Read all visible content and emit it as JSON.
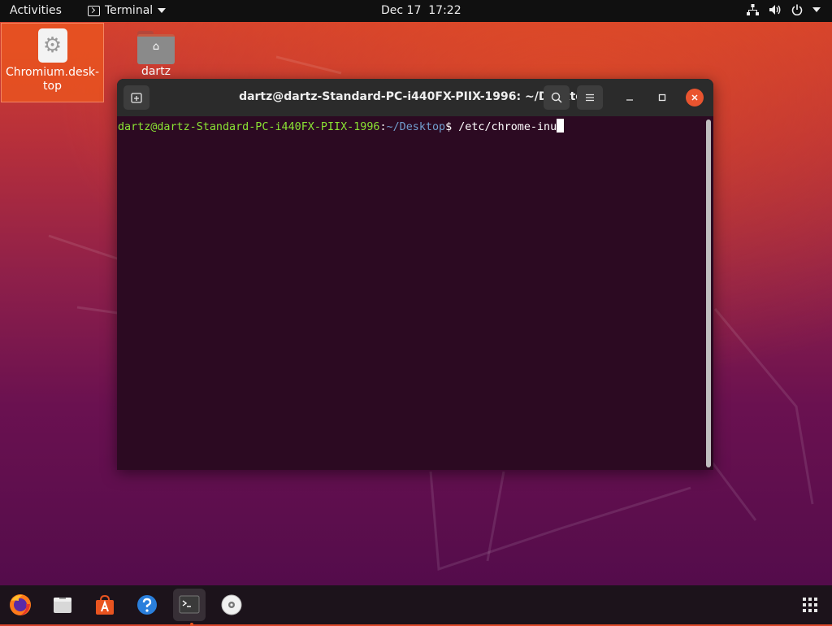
{
  "topbar": {
    "activities": "Activities",
    "app_name": "Terminal",
    "date": "Dec 17",
    "time": "17:22"
  },
  "desktop": {
    "icons": [
      {
        "label_line1": "Chromium.desk-",
        "label_line2": "top",
        "icon": "gear-icon",
        "selected": true
      },
      {
        "label": "dartz",
        "icon": "home-folder-icon"
      }
    ]
  },
  "terminal": {
    "title": "dartz@dartz-Standard-PC-i440FX-PIIX-1996: ~/Desktop",
    "prompt_user": "dartz@dartz-Standard-PC-i440FX-PIIX-1996",
    "prompt_sep": ":",
    "prompt_path": "~/Desktop",
    "prompt_symbol": "$ ",
    "command": "/etc/chrome-inu"
  },
  "dock": {
    "items": [
      {
        "name": "firefox-icon"
      },
      {
        "name": "files-icon"
      },
      {
        "name": "software-center-icon"
      },
      {
        "name": "help-icon"
      },
      {
        "name": "terminal-icon",
        "active": true
      },
      {
        "name": "disc-icon"
      }
    ],
    "show_apps": "show-applications-icon"
  },
  "colors": {
    "accent": "#e95420",
    "terminal_bg": "#2c0a22",
    "prompt_user": "#8ae234",
    "prompt_path": "#729fcf"
  }
}
